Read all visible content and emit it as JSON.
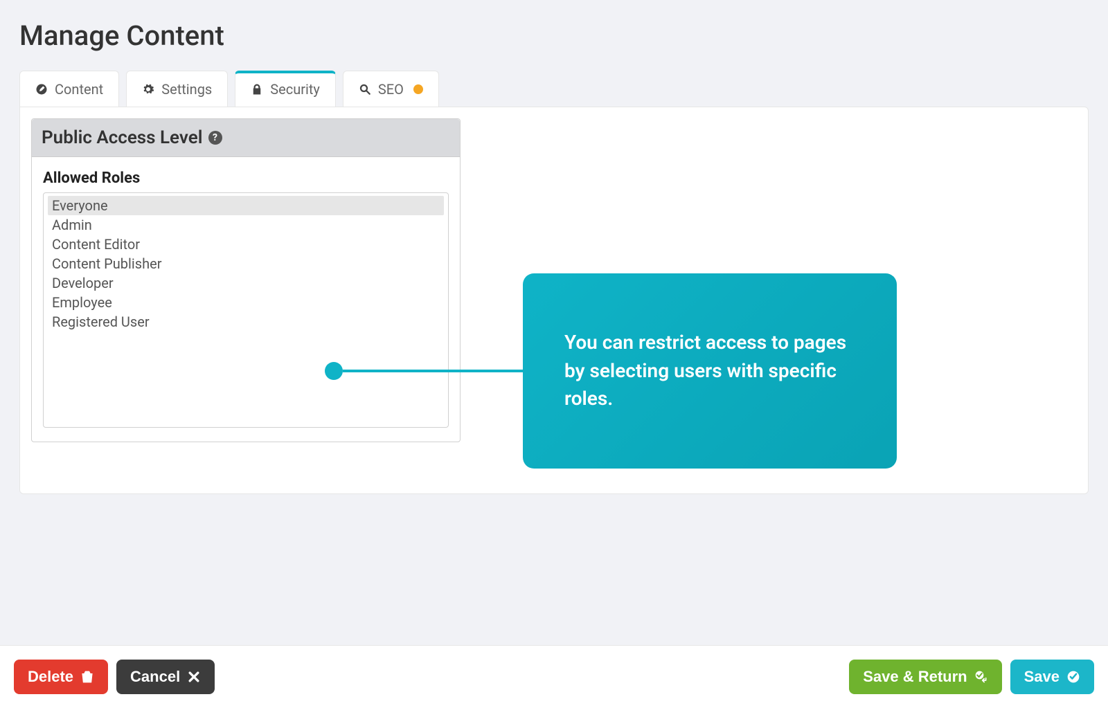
{
  "page": {
    "title": "Manage Content"
  },
  "tabs": [
    {
      "label": "Content",
      "icon": "pencil-icon"
    },
    {
      "label": "Settings",
      "icon": "gear-icon"
    },
    {
      "label": "Security",
      "icon": "lock-icon",
      "active": true
    },
    {
      "label": "SEO",
      "icon": "search-icon",
      "status_dot": true
    }
  ],
  "security_panel": {
    "header": "Public Access Level",
    "roles_label": "Allowed Roles",
    "roles": [
      {
        "name": "Everyone",
        "selected": true
      },
      {
        "name": "Admin"
      },
      {
        "name": "Content Editor"
      },
      {
        "name": "Content Publisher"
      },
      {
        "name": "Developer"
      },
      {
        "name": "Employee"
      },
      {
        "name": "Registered User"
      }
    ]
  },
  "callout": {
    "text": "You can restrict access to pages by selecting users with specific roles."
  },
  "footer": {
    "delete": "Delete",
    "cancel": "Cancel",
    "save_return": "Save & Return",
    "save": "Save"
  },
  "colors": {
    "accent": "#0fb3c7",
    "green": "#6fb32e",
    "red": "#e33b2e",
    "dark": "#3c3c3c",
    "status_dot": "#f5a623"
  }
}
